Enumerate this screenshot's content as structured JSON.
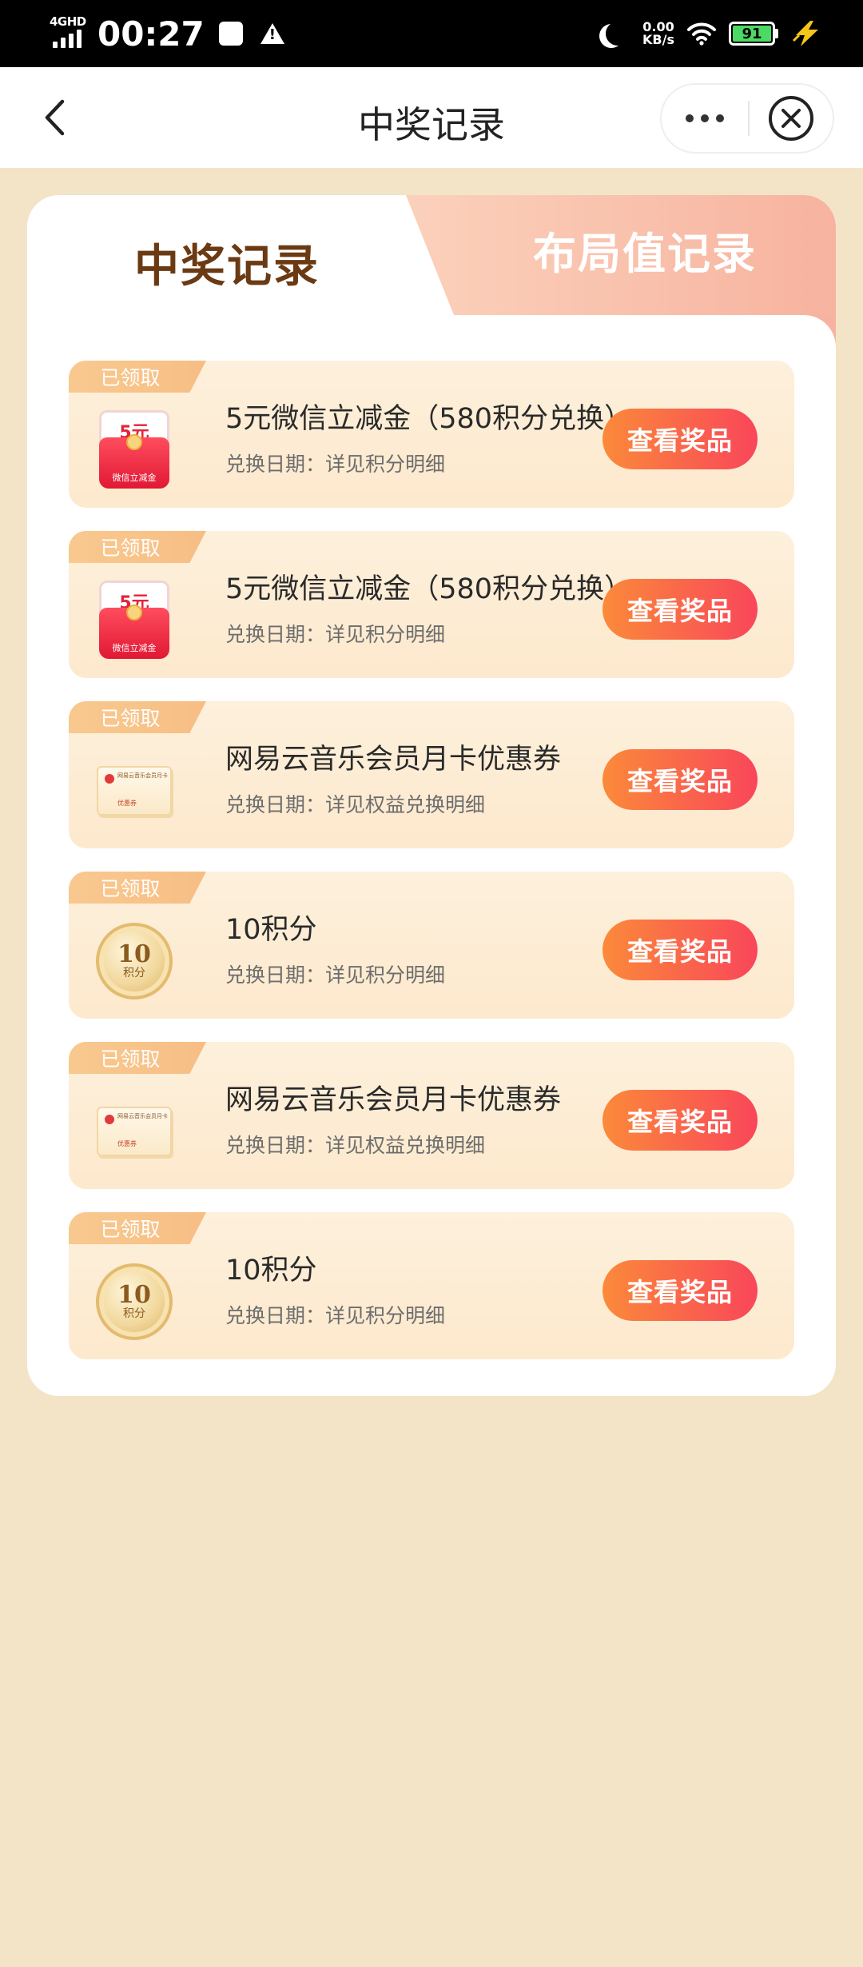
{
  "status_bar": {
    "network": "4GHD",
    "time": "00:27",
    "net_speed_value": "0.00",
    "net_speed_unit": "KB/s",
    "battery": "91",
    "battery_color": "#4cd964"
  },
  "nav": {
    "title": "中奖记录",
    "icons": [
      "chevron-left-icon",
      "more-dots-icon",
      "close-circle-icon"
    ]
  },
  "tabs": {
    "active": "中奖记录",
    "inactive": "布局值记录"
  },
  "colors": {
    "page_bg": "#f3e4c8",
    "button_gradient": [
      "#fb8a3a",
      "#f9465a"
    ],
    "badge": "#f8c98f",
    "active_tab_text": "#6b3a13"
  },
  "records": [
    {
      "badge": "已领取",
      "image": "red-envelope",
      "image_label_top": "5元",
      "image_label_bottom": "微信立减金",
      "title": "5元微信立减金（580积分兑换）",
      "date": "兑换日期：详见积分明细",
      "button": "查看奖品"
    },
    {
      "badge": "已领取",
      "image": "red-envelope",
      "image_label_top": "5元",
      "image_label_bottom": "微信立减金",
      "title": "5元微信立减金（580积分兑换）",
      "date": "兑换日期：详见积分明细",
      "button": "查看奖品"
    },
    {
      "badge": "已领取",
      "image": "coupon",
      "image_label_top": "网易云音乐会员月卡",
      "image_label_bottom": "优惠券",
      "title": "网易云音乐会员月卡优惠券",
      "date": "兑换日期：详见权益兑换明细",
      "button": "查看奖品"
    },
    {
      "badge": "已领取",
      "image": "coin",
      "image_label_top": "10",
      "image_label_bottom": "积分",
      "title": "10积分",
      "date": "兑换日期：详见积分明细",
      "button": "查看奖品"
    },
    {
      "badge": "已领取",
      "image": "coupon",
      "image_label_top": "网易云音乐会员月卡",
      "image_label_bottom": "优惠券",
      "title": "网易云音乐会员月卡优惠券",
      "date": "兑换日期：详见权益兑换明细",
      "button": "查看奖品"
    },
    {
      "badge": "已领取",
      "image": "coin",
      "image_label_top": "10",
      "image_label_bottom": "积分",
      "title": "10积分",
      "date": "兑换日期：详见积分明细",
      "button": "查看奖品"
    }
  ]
}
